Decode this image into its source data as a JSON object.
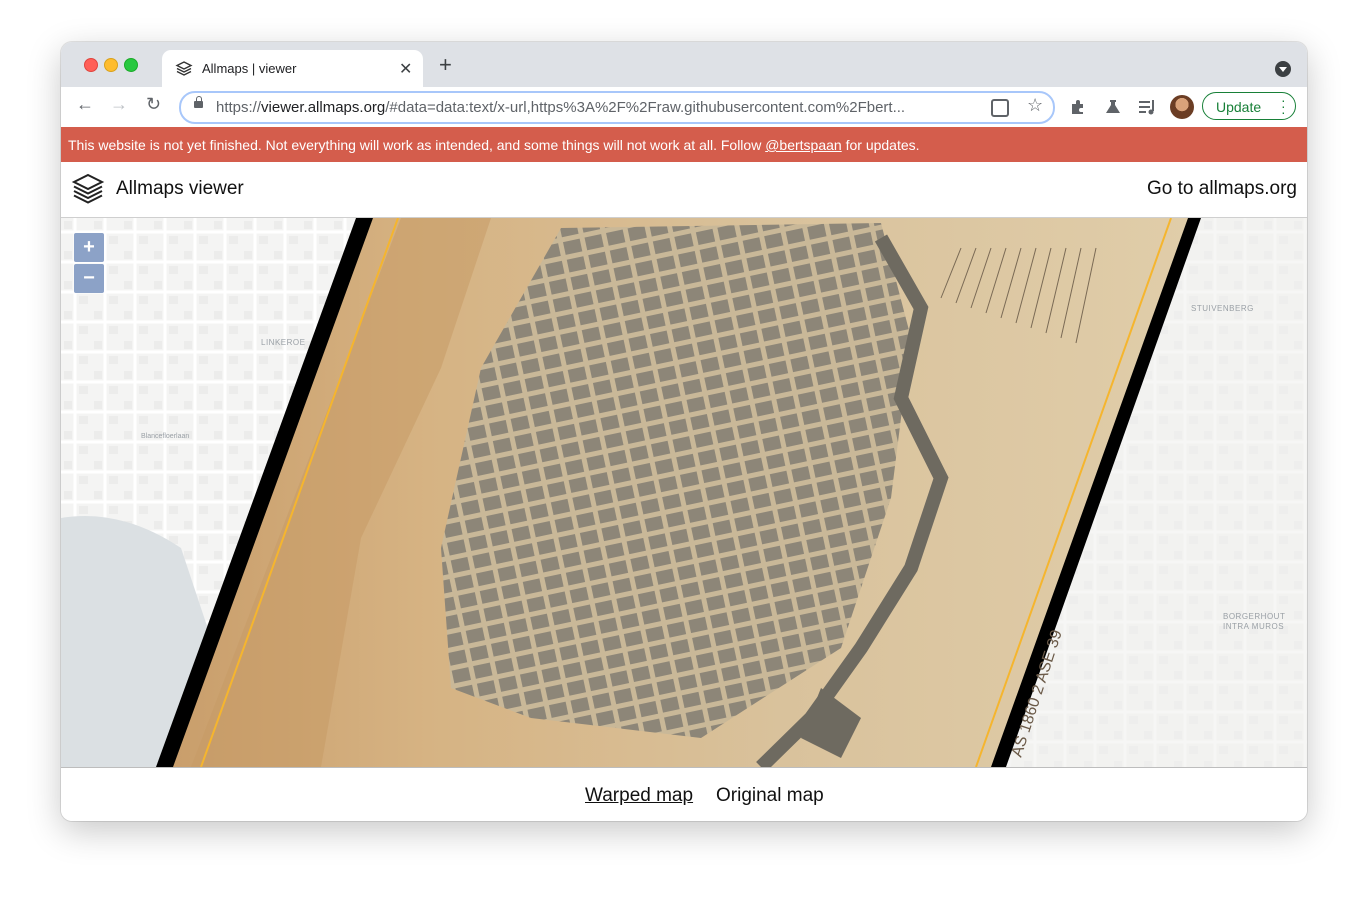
{
  "browser": {
    "tab_title": "Allmaps | viewer",
    "tab_close": "✕",
    "new_tab": "+",
    "url_prefix": "https://",
    "url_host": "viewer.allmaps.org",
    "url_rest": "/#data=data:text/x-url,https%3A%2F%2Fraw.githubusercontent.com%2Fbert...",
    "update_label": "Update",
    "icons": [
      "back-icon",
      "forward-icon",
      "reload-icon",
      "lock-icon",
      "qr-icon",
      "star-icon",
      "puzzle-icon",
      "flask-icon",
      "playlist-icon",
      "avatar",
      "kebab-icon"
    ]
  },
  "banner": {
    "text_before": "This website is not yet finished. Not everything will work as intended, and some things will not work at all. Follow ",
    "link": "@bertspaan",
    "text_after": " for updates.",
    "color": "#d45d4c"
  },
  "app": {
    "title": "Allmaps viewer",
    "external_link": "Go to allmaps.org"
  },
  "map": {
    "zoom_in": "+",
    "zoom_out": "−",
    "labels": {
      "linkeroever": "LINKEROE",
      "stuivenberg": "STUIVENBERG",
      "borgerhout1": "BORGERHOUT",
      "borgerhout2": "INTRA MUROS",
      "blancefloer": "Blancefloerlaan"
    },
    "accent_colors": {
      "boundary_line": "#f5b52e",
      "paper": "#d8c09b",
      "border": "#000000"
    }
  },
  "footer": {
    "tabs": [
      "Warped map",
      "Original map"
    ],
    "active_tab": "Warped map"
  }
}
